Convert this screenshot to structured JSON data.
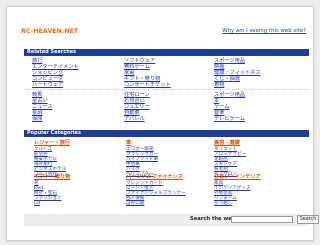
{
  "header": {
    "logo": "RC-HEAVEN.NET",
    "why_link": "Why am I seeing this web site?"
  },
  "related_searches": {
    "title": "Related Searches",
    "group1": {
      "col1": [
        "旅行",
        "エンターテイメント",
        "ショッピング",
        "コンピュータ",
        "ハードウェア"
      ],
      "col2": [
        "ソフトウェア",
        "無料ゲーム",
        "家電",
        "ギフト・贈り物",
        "コンサートチケット"
      ],
      "col3": [
        "スポーツ用品",
        "映画",
        "健康・フィットネス",
        "くじ・抽選",
        "着物"
      ]
    },
    "group2": {
      "col1": [
        "競馬",
        "星占い",
        "ニュース",
        "金融",
        "保険"
      ],
      "col2": [
        "住宅ローン",
        "お見合い",
        "ジュエリー",
        "自動車",
        "アパレル"
      ],
      "col3": [
        "スポーツ用品",
        "本",
        "ゲーム",
        "音楽",
        "テレビゲーム"
      ]
    }
  },
  "popular_categories": {
    "title": "Popular Categories",
    "cats": [
      {
        "title": "レジャー・旅行",
        "items": [
          "クルーズ",
          "航空券",
          "格安ホテル",
          "海外旅行",
          "ビジネスホテル",
          "コルフ旅行"
        ]
      },
      {
        "title": "車",
        "items": [
          "エコカー販売",
          "クラシックカー",
          "ハイブリッド車",
          "中古車",
          "バイク",
          "ヘリコプター"
        ]
      },
      {
        "title": "美容・健康",
        "items": [
          "ダイエット",
          "アロマテラピー",
          "化粧品",
          "スキンケア",
          "育毛剤",
          "ヘアサロン"
        ]
      },
      {
        "title": "ギフト・贈り物",
        "items": [
          "花",
          "Dvd",
          "時計・宝石",
          "ファッション",
          "Cd"
        ]
      },
      {
        "title": "パーソナルファイナンス",
        "items": [
          "クレジットカード",
          "ローン・借入",
          "ファイナンシャルプランナー",
          "個人保険",
          "証券口座"
        ]
      },
      {
        "title": "住まい・インテリア",
        "items": [
          "家具",
          "インテリアグッズ",
          "外壁塗装",
          "リフォーム",
          "引っ越し"
        ]
      }
    ]
  },
  "search": {
    "label": "Search the web:",
    "value": "",
    "button": "Search"
  }
}
